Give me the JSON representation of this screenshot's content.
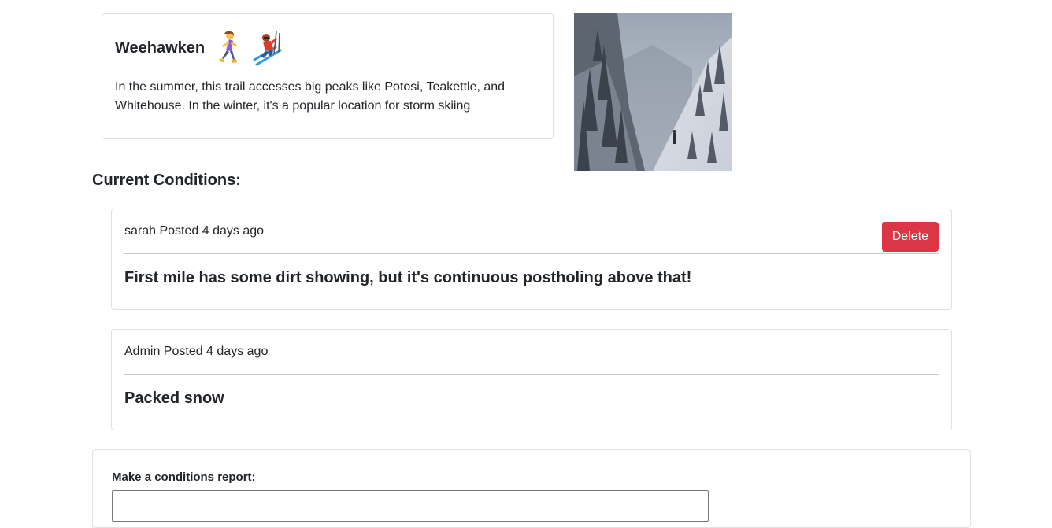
{
  "trail": {
    "name": "Weehawken",
    "activity_icons": [
      "woman-running-icon",
      "skier-icon"
    ],
    "description": "In the summer, this trail accesses big peaks like Potosi, Teakettle, and Whitehouse. In the winter, it's a popular location for storm skiing"
  },
  "conditions": {
    "heading": "Current Conditions:",
    "reports": [
      {
        "author": "sarah",
        "meta": "sarah Posted 4 days ago",
        "text": "First mile has some dirt showing, but it's continuous postholing above that!",
        "delete_label": "Delete"
      },
      {
        "author": "Admin",
        "meta": "Admin Posted 4 days ago",
        "text": "Packed snow"
      }
    ]
  },
  "report_form": {
    "label": "Make a conditions report:",
    "value": "",
    "placeholder": ""
  },
  "colors": {
    "danger": "#dc3545",
    "border": "#dee2e6",
    "text": "#212529"
  }
}
